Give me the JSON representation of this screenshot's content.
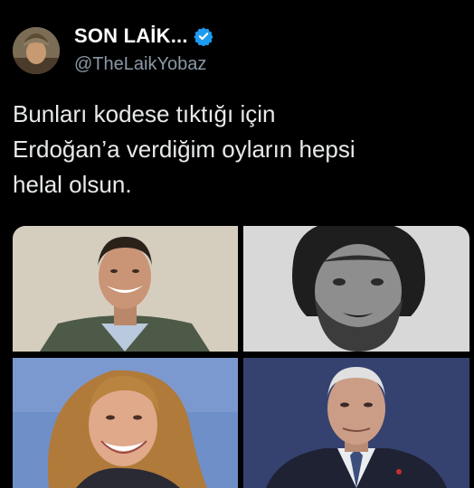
{
  "tweet": {
    "display_name": "SON LAİK...",
    "handle": "@TheLaikYobaz",
    "text_lines": [
      "Bunları kodese tıktığı için",
      "Erdoğan’a verdiğim oyların hepsi",
      "helal olsun."
    ]
  },
  "icons": {
    "verified": "verified-badge-icon"
  },
  "colors": {
    "background": "#000000",
    "text": "#e7e9ea",
    "handle": "#8b98a5",
    "verified": "#1d9bf0"
  }
}
